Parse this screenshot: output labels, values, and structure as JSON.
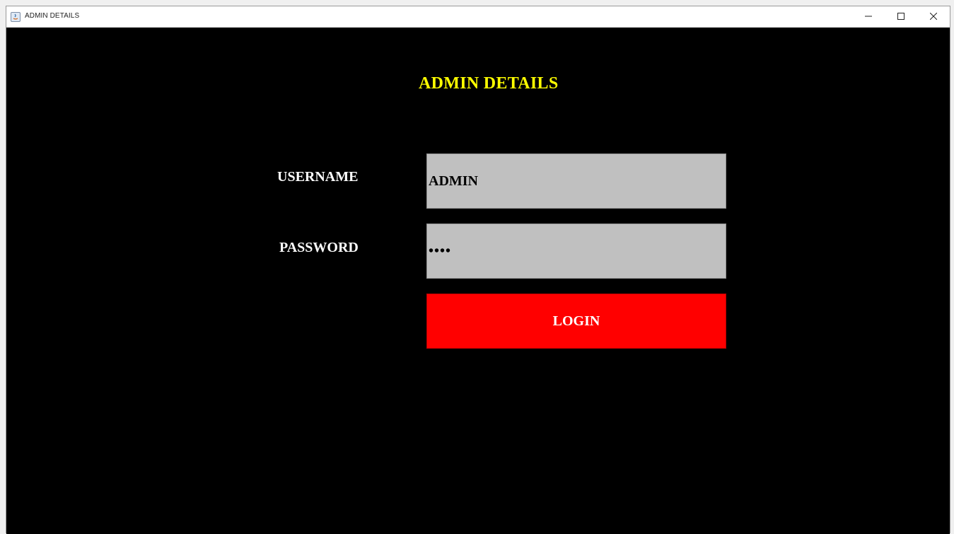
{
  "window": {
    "title": "ADMIN DETAILS",
    "controls": {
      "minimize": "–",
      "maximize": "☐",
      "close": "✕"
    }
  },
  "form": {
    "heading": "ADMIN DETAILS",
    "username_label": "USERNAME",
    "username_value": "ADMIN",
    "password_label": "PASSWORD",
    "password_value": "••••",
    "login_label": "LOGIN"
  },
  "colors": {
    "background": "#000000",
    "heading": "#ffff00",
    "label": "#ffffff",
    "field_background": "#c0c0c0",
    "login_button": "#ff0000"
  },
  "icons": {
    "app": "java-app-icon",
    "minimize": "minimize-icon",
    "maximize": "maximize-icon",
    "close": "close-icon"
  }
}
